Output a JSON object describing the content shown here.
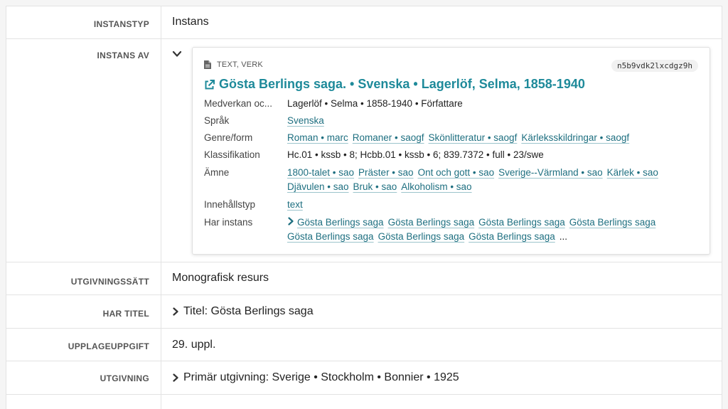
{
  "rows": {
    "instanstyp": {
      "label": "INSTANSTYP",
      "value": "Instans"
    },
    "instans_av": {
      "label": "INSTANS AV",
      "card": {
        "type_label": "TEXT, VERK",
        "id": "n5b9vdk2lxcdgz9h",
        "title": "Gösta Berlings saga. • Svenska • Lagerlöf, Selma, 1858-1940",
        "props": {
          "medverkan": {
            "key": "Medverkan oc...",
            "value": "Lagerlöf • Selma • 1858-1940 • Författare"
          },
          "sprak": {
            "key": "Språk",
            "links": [
              "Svenska"
            ]
          },
          "genre": {
            "key": "Genre/form",
            "links": [
              "Roman • marc",
              "Romaner • saogf",
              "Skönlitteratur • saogf",
              "Kärleksskildringar • saogf"
            ]
          },
          "klass": {
            "key": "Klassifikation",
            "value": "Hc.01 • kssb • 8; Hcbb.01 • kssb • 6; 839.7372 • full • 23/swe"
          },
          "amne": {
            "key": "Ämne",
            "links": [
              "1800-talet • sao",
              "Präster • sao",
              "Ont och gott • sao",
              "Sverige--Värmland • sao",
              "Kärlek • sao",
              "Djävulen • sao",
              "Bruk • sao",
              "Alkoholism • sao"
            ]
          },
          "innehall": {
            "key": "Innehållstyp",
            "links": [
              "text"
            ]
          },
          "harinstans": {
            "key": "Har instans",
            "links": [
              "Gösta Berlings saga",
              "Gösta Berlings saga",
              "Gösta Berlings saga",
              "Gösta Berlings saga",
              "Gösta Berlings saga",
              "Gösta Berlings saga",
              "Gösta Berlings saga"
            ],
            "more": "..."
          }
        }
      }
    },
    "utgivningssatt": {
      "label": "UTGIVNINGSSÄTT",
      "value": "Monografisk resurs"
    },
    "har_titel": {
      "label": "HAR TITEL",
      "value": "Titel: Gösta Berlings saga"
    },
    "upplaga": {
      "label": "UPPLAGEUPPGIFT",
      "value": "29. uppl."
    },
    "utgivning": {
      "label": "UTGIVNING",
      "value": "Primär utgivning: Sverige • Stockholm • Bonnier • 1925"
    }
  },
  "icons": {
    "expand": "chevron-down-icon",
    "collapse": "chevron-right-icon",
    "doc": "document-icon",
    "ext": "external-link-icon"
  },
  "colors": {
    "link": "#1e6f80",
    "title": "#1e8a9a"
  }
}
